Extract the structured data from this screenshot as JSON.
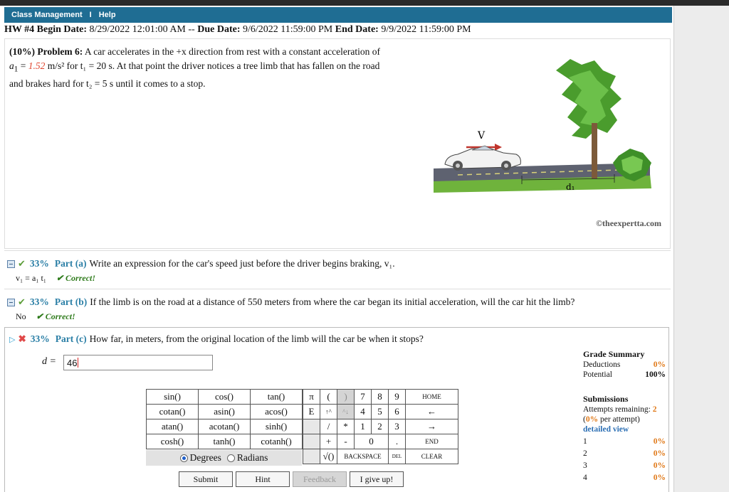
{
  "menu": {
    "items": [
      "Class Management",
      "I",
      "Help"
    ]
  },
  "hw": {
    "title": "HW #4",
    "begin_label": "Begin Date:",
    "begin": "8/29/2022 12:01:00 AM",
    "sep": "--",
    "due_label": "Due Date:",
    "due": "9/6/2022 11:59:00 PM",
    "end_label": "End Date:",
    "end": "9/9/2022 11:59:00 PM"
  },
  "problem": {
    "weight": "(10%)",
    "label": "Problem 6:",
    "text1": "A car accelerates in the +x direction from rest with a constant acceleration of",
    "a1_sym": "a",
    "a1_value": "1.52",
    "text2": "m/s² for t₁ = 20 s. At that point the driver notices a tree limb that has fallen on the road",
    "text3": "and brakes hard for t₂ = 5 s until it comes to a stop.",
    "illustration_v": "V",
    "illustration_d": "d₁",
    "credit": "©theexpertta.com"
  },
  "part_a": {
    "percent": "33%",
    "label": "Part (a)",
    "question": "Write an expression for the car's speed just before the driver begins braking, v₁.",
    "answer": "v₁ = a₁ t₁",
    "status": "✔ Correct!"
  },
  "part_b": {
    "percent": "33%",
    "label": "Part (b)",
    "question": "If the limb is on the road at a distance of 550 meters from where the car began its initial acceleration, will the car hit the limb?",
    "answer": "No",
    "status": "✔ Correct!"
  },
  "part_c": {
    "percent": "33%",
    "label": "Part (c)",
    "question": "How far, in meters, from the original location of the limb will the car be when it stops?",
    "var_label": "d =",
    "input_value": "46"
  },
  "functions": [
    [
      "sin()",
      "cos()",
      "tan()"
    ],
    [
      "cotan()",
      "asin()",
      "acos()"
    ],
    [
      "atan()",
      "acotan()",
      "sinh()"
    ],
    [
      "cosh()",
      "tanh()",
      "cotanh()"
    ]
  ],
  "angle_mode": {
    "degrees": "Degrees",
    "radians": "Radians",
    "selected": "Degrees"
  },
  "keypad": {
    "pi": "π",
    "lparen": "(",
    "rparen": ")",
    "k7": "7",
    "k8": "8",
    "k9": "9",
    "home": "HOME",
    "e": "E",
    "up": "↑^",
    "down": "^↓",
    "k4": "4",
    "k5": "5",
    "k6": "6",
    "left": "←",
    "div": "/",
    "mul": "*",
    "k1": "1",
    "k2": "2",
    "k3": "3",
    "right": "→",
    "plus": "+",
    "minus": "-",
    "k0": "0",
    "dot": ".",
    "end": "END",
    "sqrt": "√()",
    "backspace": "BACKSPACE",
    "del": "DEL",
    "clear": "CLEAR"
  },
  "buttons": {
    "submit": "Submit",
    "hint": "Hint",
    "feedback": "Feedback",
    "give_up": "I give up!"
  },
  "grade_summary": {
    "title": "Grade Summary",
    "deductions_label": "Deductions",
    "deductions": "0%",
    "potential_label": "Potential",
    "potential": "100%"
  },
  "submissions": {
    "title": "Submissions",
    "attempts_label": "Attempts remaining:",
    "attempts": "2",
    "per_attempt_pct": "0%",
    "per_attempt_label": "per attempt)",
    "detailed": "detailed view",
    "rows": [
      {
        "n": "1",
        "pct": "0%"
      },
      {
        "n": "2",
        "pct": "0%"
      },
      {
        "n": "3",
        "pct": "0%"
      },
      {
        "n": "4",
        "pct": "0%"
      }
    ]
  },
  "colors": {
    "menubar": "#1f6d93",
    "percent": "#2b7fa6",
    "highlight": "#e0452f",
    "correct": "#2d7a1a",
    "orange": "#e07a1a"
  }
}
